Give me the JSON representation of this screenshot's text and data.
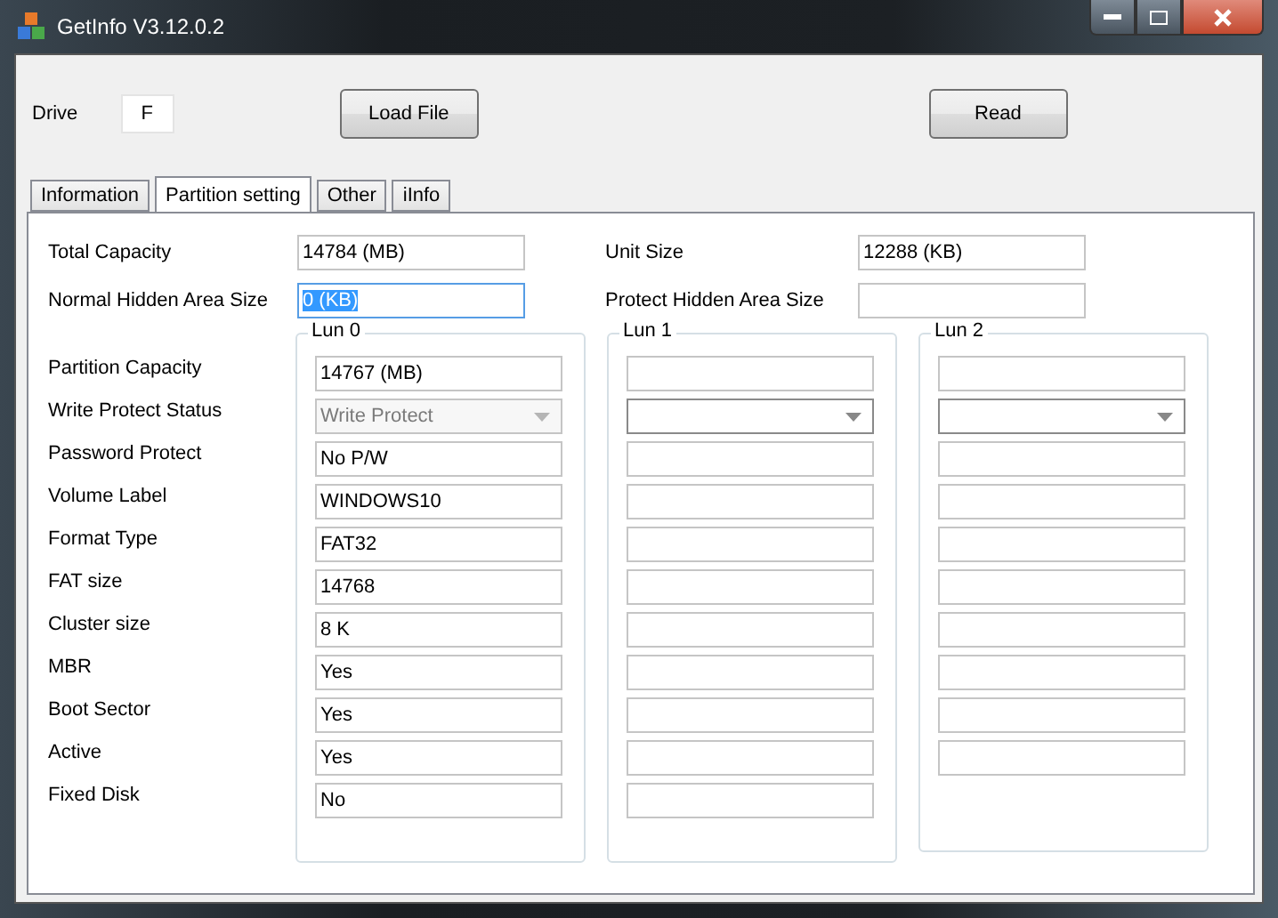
{
  "window": {
    "title": "GetInfo V3.12.0.2"
  },
  "drive": {
    "label": "Drive",
    "value": "F"
  },
  "buttons": [
    {
      "label": "Load File"
    },
    {
      "label": "Read"
    }
  ],
  "tabs": [
    {
      "label": "Information",
      "selected": false
    },
    {
      "label": "Partition setting",
      "selected": true
    },
    {
      "label": "Other",
      "selected": false
    },
    {
      "label": "iInfo",
      "selected": false
    }
  ],
  "summary": [
    {
      "label": "Total Capacity",
      "value": "14784 (MB)",
      "selected": false
    },
    {
      "label": "Unit Size",
      "value": "12288 (KB)",
      "selected": false
    },
    {
      "label": "Normal Hidden Area Size",
      "value": "0 (KB)",
      "selected": true
    },
    {
      "label": "Protect Hidden Area Size",
      "selected": false
    }
  ],
  "row_labels": [
    "Partition Capacity",
    "Write Protect Status",
    "Password Protect",
    "Volume Label",
    "Format Type",
    "FAT size",
    "Cluster size",
    "MBR",
    "Boot Sector",
    "Active",
    "Fixed Disk"
  ],
  "luns": [
    {
      "title": "Lun 0",
      "fields": [
        {
          "kind": "text",
          "value": "14767 (MB)"
        },
        {
          "kind": "combo",
          "value": "Write Protect",
          "disabled": true
        },
        {
          "kind": "text",
          "value": "No P/W"
        },
        {
          "kind": "text",
          "value": "WINDOWS10"
        },
        {
          "kind": "text",
          "value": "FAT32"
        },
        {
          "kind": "text",
          "value": "14768"
        },
        {
          "kind": "text",
          "value": "8 K"
        },
        {
          "kind": "text",
          "value": "Yes"
        },
        {
          "kind": "text",
          "value": "Yes"
        },
        {
          "kind": "text",
          "value": "Yes"
        },
        {
          "kind": "text",
          "value": "No"
        }
      ]
    },
    {
      "title": "Lun 1",
      "fields": [
        {
          "kind": "text"
        },
        {
          "kind": "combo",
          "disabled": false
        },
        {
          "kind": "text"
        },
        {
          "kind": "text"
        },
        {
          "kind": "text"
        },
        {
          "kind": "text"
        },
        {
          "kind": "text"
        },
        {
          "kind": "text"
        },
        {
          "kind": "text"
        },
        {
          "kind": "text"
        },
        {
          "kind": "text"
        }
      ]
    },
    {
      "title": "Lun 2",
      "fields": [
        {
          "kind": "text"
        },
        {
          "kind": "combo",
          "disabled": false
        },
        {
          "kind": "text"
        },
        {
          "kind": "text"
        },
        {
          "kind": "text"
        },
        {
          "kind": "text"
        },
        {
          "kind": "text"
        },
        {
          "kind": "text"
        },
        {
          "kind": "text"
        },
        {
          "kind": "text"
        }
      ]
    }
  ]
}
